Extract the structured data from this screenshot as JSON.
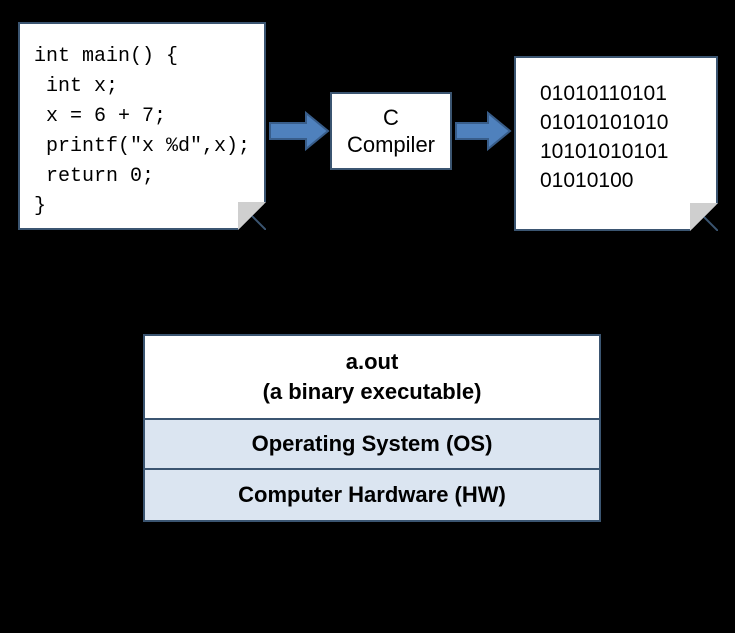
{
  "source_code": "int main() {\n int x;\n x = 6 + 7;\n printf(\"x %d\",x);\n return 0;\n}",
  "compiler": {
    "line1": "C",
    "line2": "Compiler"
  },
  "binary_output": "01010110101\n01010101010\n10101010101\n01010100",
  "stack": {
    "top_line1": "a.out",
    "top_line2": "(a binary executable)",
    "os": "Operating System (OS)",
    "hw": "Computer Hardware (HW)"
  },
  "colors": {
    "arrow": "#4f81bd",
    "arrow_border": "#385d8a",
    "box_border": "#3b5571",
    "stack_fill": "#dbe5f1"
  }
}
